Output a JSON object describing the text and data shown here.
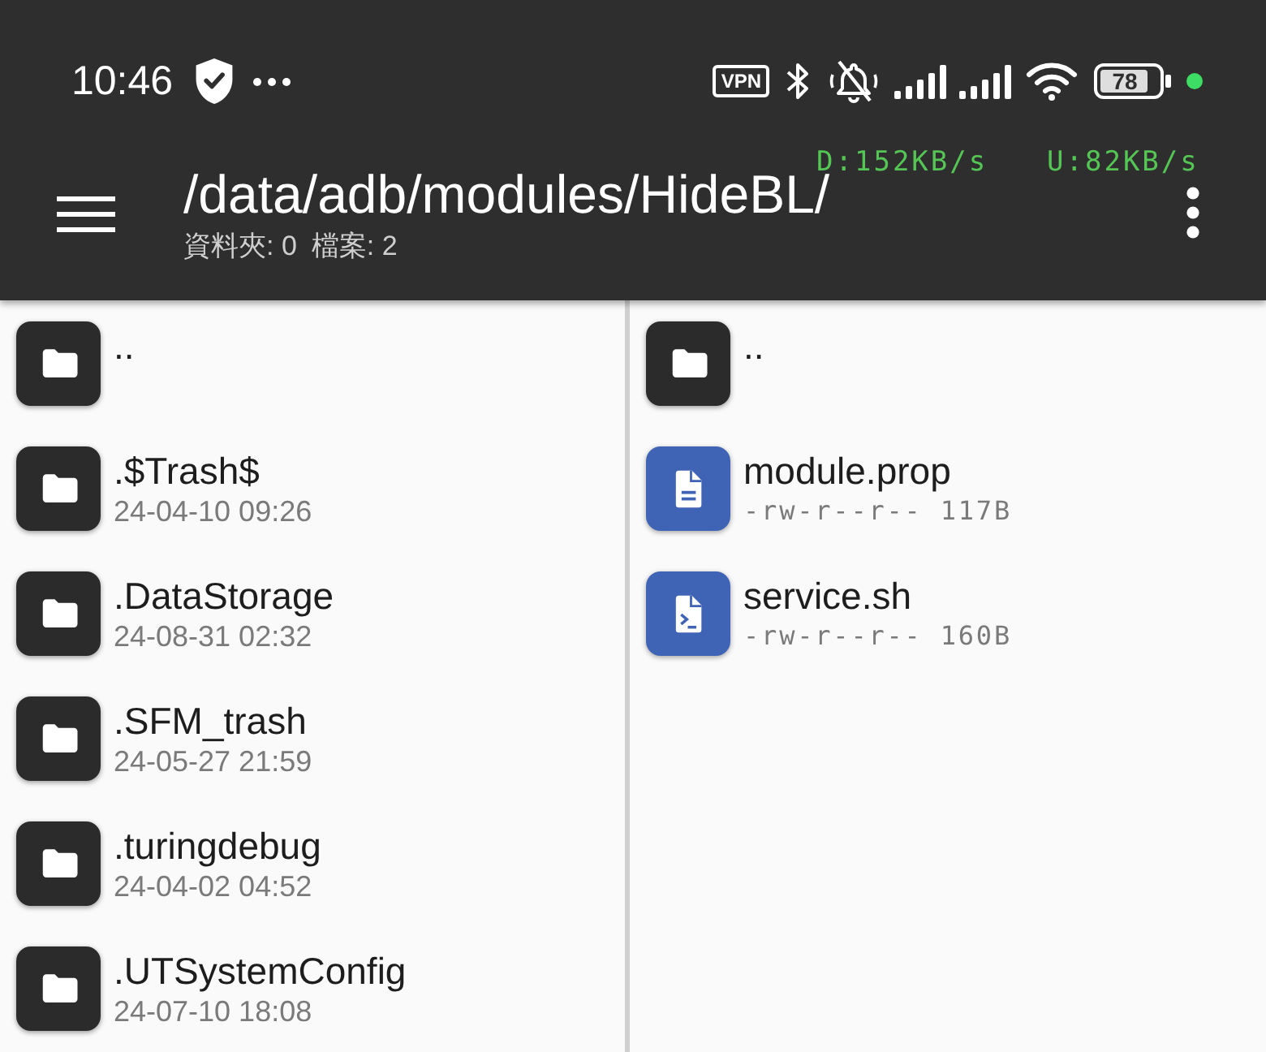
{
  "status_bar": {
    "time": "10:46",
    "vpn_badge": "VPN",
    "battery_percentage": "78"
  },
  "network_speed": {
    "download": "D:152KB/s",
    "upload": "U:82KB/s"
  },
  "app_bar": {
    "title": "/data/adb/modules/HideBL/",
    "folder_count": "資料夾: 0",
    "file_count": "檔案: 2"
  },
  "panes": [
    {
      "items": [
        {
          "kind": "folder",
          "name": ".."
        },
        {
          "kind": "folder",
          "name": ".$Trash$",
          "detail": "24-04-10 09:26"
        },
        {
          "kind": "folder",
          "name": ".DataStorage",
          "detail": "24-08-31 02:32"
        },
        {
          "kind": "folder",
          "name": ".SFM_trash",
          "detail": "24-05-27 21:59"
        },
        {
          "kind": "folder",
          "name": ".turingdebug",
          "detail": "24-04-02 04:52"
        },
        {
          "kind": "folder",
          "name": ".UTSystemConfig",
          "detail": "24-07-10 18:08"
        }
      ]
    },
    {
      "items": [
        {
          "kind": "folder",
          "name": ".."
        },
        {
          "kind": "document",
          "name": "module.prop",
          "detail": "-rw-r--r-- 117B"
        },
        {
          "kind": "script",
          "name": "service.sh",
          "detail": "-rw-r--r-- 160B"
        }
      ]
    }
  ]
}
